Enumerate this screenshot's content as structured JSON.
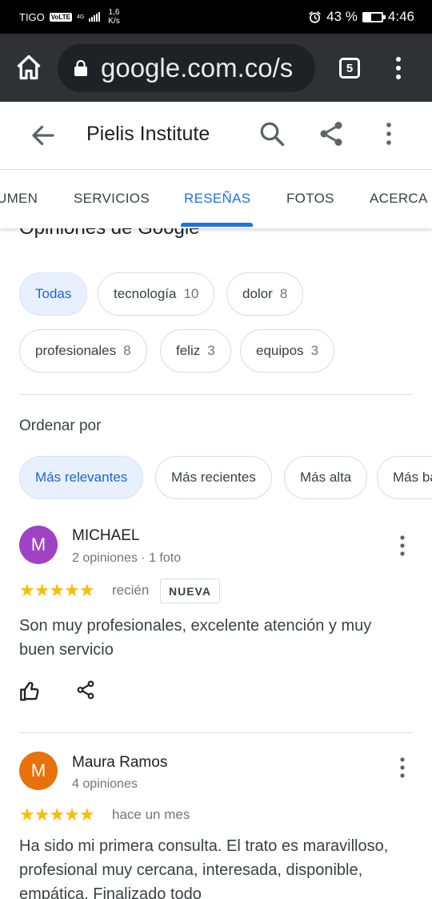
{
  "status_bar": {
    "carrier": "TIGO",
    "volte": "VoLTE",
    "network": "4G",
    "speed_value": "1,6",
    "speed_unit": "K/s",
    "battery": "43 %",
    "battery_level": 0.43,
    "time": "4:46"
  },
  "browser": {
    "url": "google.com.co/s",
    "tab_count": "5"
  },
  "header": {
    "title": "Pielis Institute"
  },
  "tabs": [
    {
      "label": "UMEN",
      "active": false
    },
    {
      "label": "SERVICIOS",
      "active": false
    },
    {
      "label": "RESEÑAS",
      "active": true
    },
    {
      "label": "FOTOS",
      "active": false
    },
    {
      "label": "ACERCA DE",
      "active": false
    }
  ],
  "reviews_section": {
    "title": "Opiniones de Google",
    "topic_chips": [
      {
        "label": "Todas",
        "count": "",
        "selected": true
      },
      {
        "label": "tecnología",
        "count": "10",
        "selected": false
      },
      {
        "label": "dolor",
        "count": "8",
        "selected": false
      },
      {
        "label": "profesionales",
        "count": "8",
        "selected": false
      },
      {
        "label": "feliz",
        "count": "3",
        "selected": false
      },
      {
        "label": "equipos",
        "count": "3",
        "selected": false
      }
    ],
    "sort_label": "Ordenar por",
    "sort_chips": [
      {
        "label": "Más relevantes",
        "selected": true
      },
      {
        "label": "Más recientes",
        "selected": false
      },
      {
        "label": "Más alta",
        "selected": false
      },
      {
        "label": "Más baja",
        "selected": false
      }
    ]
  },
  "reviews": [
    {
      "initial": "M",
      "avatar_color": "#a142c5",
      "name": "MICHAEL",
      "meta": "2 opiniones · 1 foto",
      "rating": 5,
      "stars": "★★★★★",
      "date": "recién",
      "badge": "NUEVA",
      "text": "Son muy profesionales, excelente atención y muy buen servicio"
    },
    {
      "initial": "M",
      "avatar_color": "#e8710a",
      "name": "Maura Ramos",
      "meta": "4 opiniones",
      "rating": 5,
      "stars": "★★★★★",
      "date": "hace un mes",
      "text": "Ha sido mi primera consulta. El trato es maravilloso, profesional muy cercana, interesada, disponible, empática. Finalizado todo"
    }
  ],
  "colors": {
    "accent": "#1a73e8",
    "star": "#fbbc04",
    "selected_chip_bg": "#e8f0fe"
  }
}
